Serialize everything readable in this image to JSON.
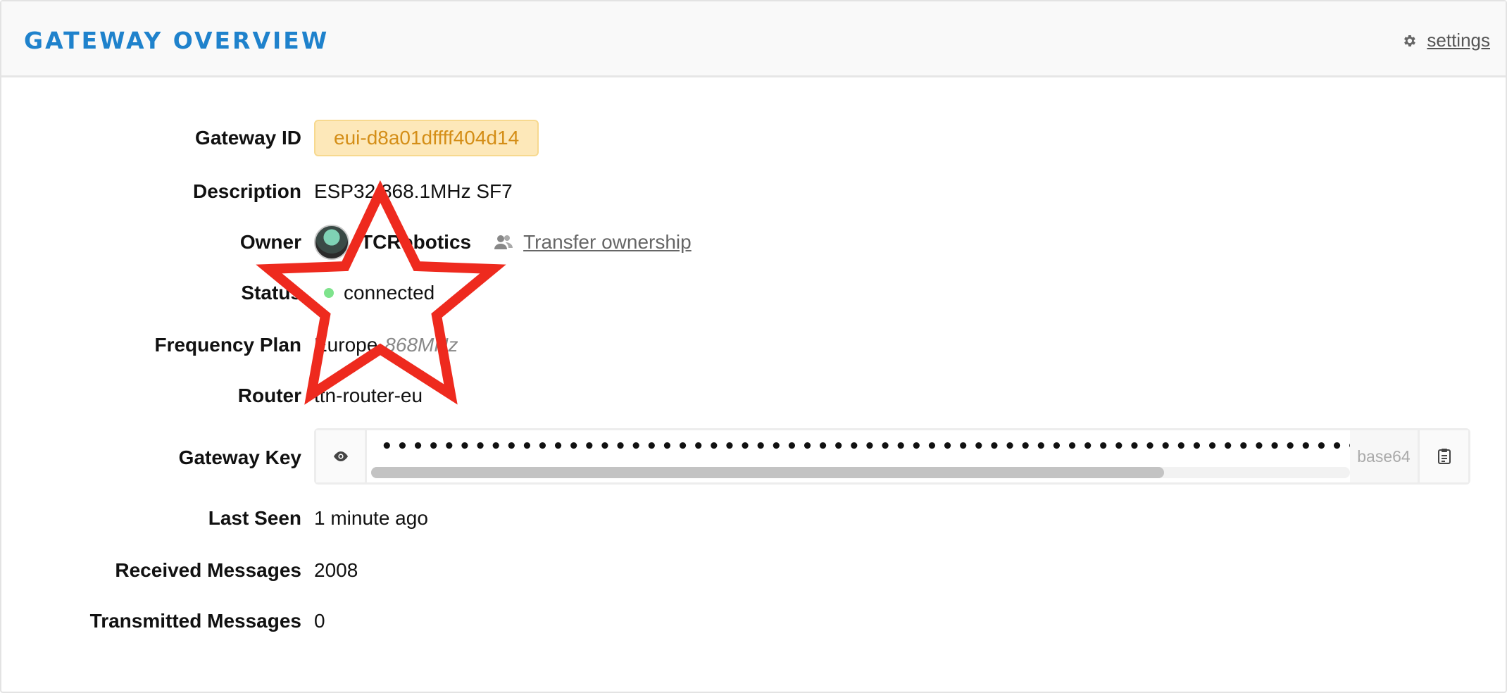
{
  "header": {
    "title": "GATEWAY OVERVIEW",
    "settings_label": "settings",
    "settings_icon": "gear-icon"
  },
  "fields": {
    "gateway_id": {
      "label": "Gateway ID",
      "value": "eui-d8a01dffff404d14"
    },
    "description": {
      "label": "Description",
      "value": "ESP32 868.1MHz SF7"
    },
    "owner": {
      "label": "Owner",
      "name": "TCRobotics",
      "transfer_label": "Transfer ownership",
      "transfer_icon": "users-icon"
    },
    "status": {
      "label": "Status",
      "value": "connected",
      "dot_color": "#7ee38c"
    },
    "frequency_plan": {
      "label": "Frequency Plan",
      "value": "Europe",
      "sub": "868MHz"
    },
    "router": {
      "label": "Router",
      "value": "ttn-router-eu"
    },
    "gateway_key": {
      "label": "Gateway Key",
      "masked_value": "••••••••••••••••••••••••••••••••••••••••••••••••••••••••••••••••••••••••••••••••••••••••••••••••••••••••••••••",
      "format": "base64",
      "reveal_icon": "eye-icon",
      "copy_icon": "clipboard-icon",
      "scroll_fraction": 0.81
    },
    "last_seen": {
      "label": "Last Seen",
      "value": "1 minute ago"
    },
    "received_messages": {
      "label": "Received Messages",
      "value": "2008"
    },
    "transmitted_messages": {
      "label": "Transmitted Messages",
      "value": "0"
    }
  },
  "colors": {
    "title": "#1f82cc",
    "id_badge_bg": "#fde8b9",
    "id_badge_text": "#d48e17",
    "annotation_star": "#ee2a1e"
  }
}
